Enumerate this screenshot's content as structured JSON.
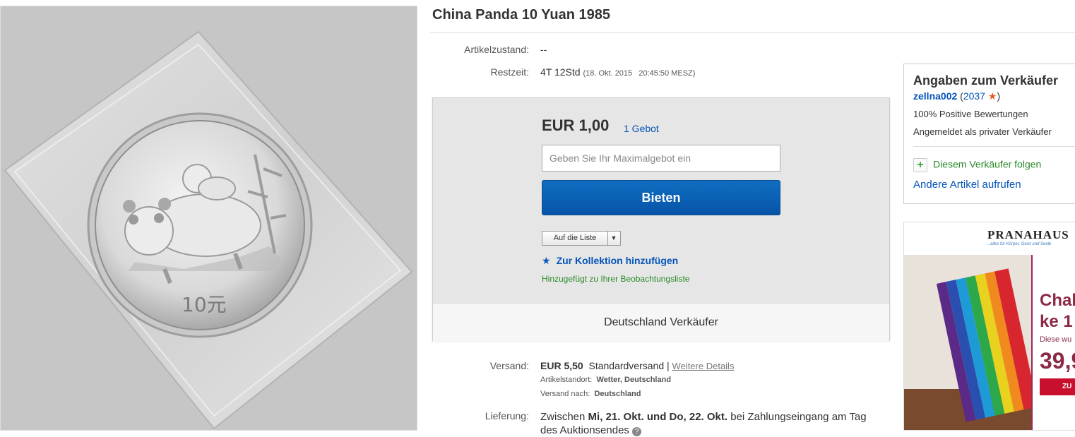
{
  "listing": {
    "title": "China Panda 10 Yuan 1985",
    "condition_label": "Artikelzustand:",
    "condition_value": "--",
    "time_label": "Restzeit:",
    "time_value": "4T 12Std",
    "time_end": "(18. Okt. 2015   20:45:50 MESZ)"
  },
  "image": {
    "coin_denomination": "10元"
  },
  "bid": {
    "price": "EUR 1,00",
    "bid_count": "1 Gebot",
    "input_placeholder": "Geben Sie Ihr Maximalgebot ein",
    "bid_button": "Bieten",
    "watchlist_button": "Auf die Liste",
    "collection_link": "Zur Kollektion hinzufügen",
    "added_note": "Hinzugefügt zu Ihrer Beobachtungsliste",
    "seller_location": "Deutschland Verkäufer"
  },
  "shipping": {
    "label": "Versand:",
    "price": "EUR 5,50",
    "method": "Standardversand",
    "separator": "|",
    "details_link": "Weitere Details",
    "location_label": "Artikelstandort:",
    "location_value": "Wetter, Deutschland",
    "ships_to_label": "Versand nach:",
    "ships_to_value": "Deutschland"
  },
  "delivery": {
    "label": "Lieferung:",
    "prefix": "Zwischen",
    "dates": "Mi, 21. Okt. und Do, 22. Okt.",
    "suffix": "bei Zahlungseingang am Tag",
    "line2": "des Auktionsendes"
  },
  "seller": {
    "heading": "Angaben zum Verkäufer",
    "name": "zellna002",
    "feedback_count": "2037",
    "positive": "100% Positive Bewertungen",
    "registered": "Angemeldet als privater Verkäufer",
    "follow": "Diesem Verkäufer folgen",
    "other_items": "Andere Artikel aufrufen"
  },
  "ad": {
    "brand": "PRANAHAUS",
    "tagline": "...alles für Körper, Geist und Seele",
    "headline_1": "Chal",
    "headline_2": "ke 1",
    "subline": "Diese wu",
    "price": "39,9",
    "button": "ZU"
  },
  "colors": {
    "link": "#0654ba",
    "bid_button": "#0654a8",
    "success_green": "#2a8a2a",
    "star": "#e65c1e",
    "ad_accent": "#8b2a45"
  }
}
